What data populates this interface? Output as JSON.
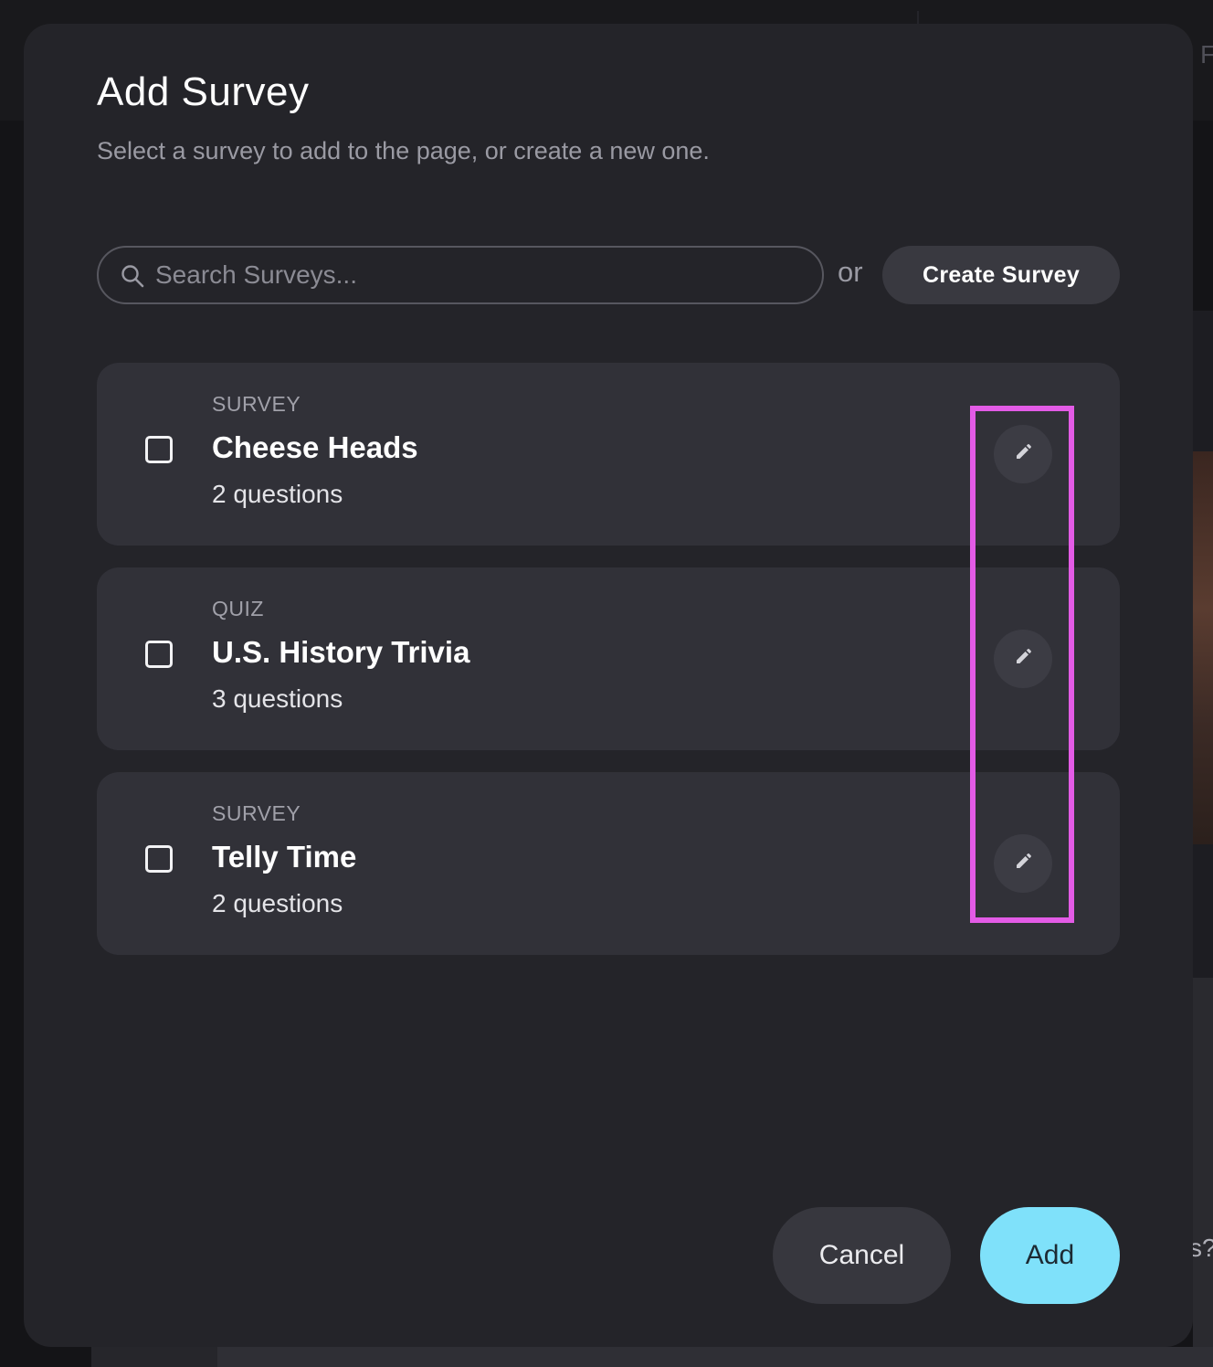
{
  "modal": {
    "title": "Add Survey",
    "subtitle": "Select a survey to add to the page, or create a new one."
  },
  "search": {
    "placeholder": "Search Surveys...",
    "value": ""
  },
  "or_label": "or",
  "create_button": "Create Survey",
  "surveys": [
    {
      "type": "SURVEY",
      "name": "Cheese Heads",
      "count": "2 questions",
      "checked": false
    },
    {
      "type": "QUIZ",
      "name": "U.S. History Trivia",
      "count": "3 questions",
      "checked": false
    },
    {
      "type": "SURVEY",
      "name": "Telly Time",
      "count": "2 questions",
      "checked": false
    }
  ],
  "actions": {
    "cancel": "Cancel",
    "add": "Add"
  },
  "background": {
    "top_right_glyph": "F",
    "right_edge_text": "s?"
  },
  "colors": {
    "modal_bg": "#242429",
    "card_bg": "#313138",
    "accent": "#7fe1fa",
    "highlight": "#e35be6"
  },
  "icons": {
    "search": "search-icon",
    "edit": "pencil-icon",
    "checkbox": "checkbox-unchecked-icon"
  }
}
